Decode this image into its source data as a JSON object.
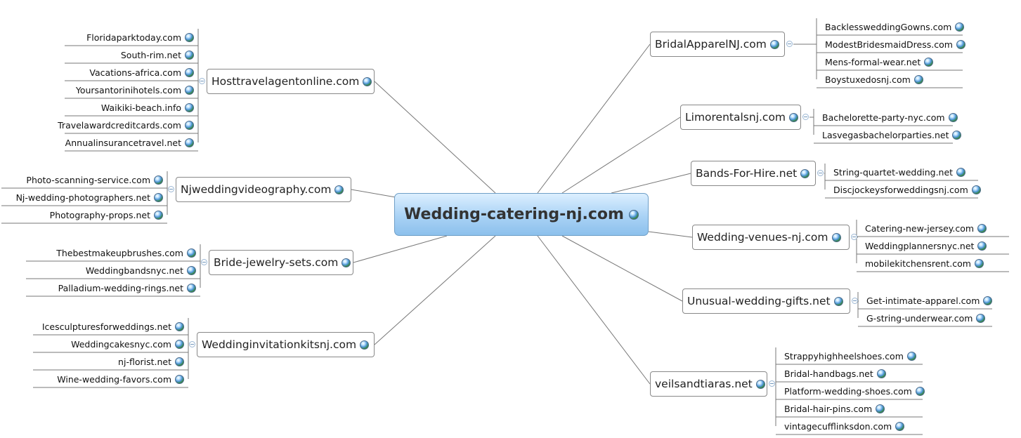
{
  "center": {
    "label": "Wedding-catering-nj.com"
  },
  "branches": [
    {
      "label": "Hosttravelagentonline.com",
      "children": [
        "Floridaparktoday.com",
        "South-rim.net",
        "Vacations-africa.com",
        "Yoursantorinihotels.com",
        "Waikiki-beach.info",
        "Travelawardcreditcards.com",
        "Annualinsurancetravel.net"
      ]
    },
    {
      "label": "Njweddingvideography.com",
      "children": [
        "Photo-scanning-service.com",
        "Nj-wedding-photographers.net",
        "Photography-props.net"
      ]
    },
    {
      "label": "Bride-jewelry-sets.com",
      "children": [
        "Thebestmakeupbrushes.com",
        "Weddingbandsnyc.net",
        "Palladium-wedding-rings.net"
      ]
    },
    {
      "label": "Weddinginvitationkitsnj.com",
      "children": [
        "Icesculpturesforweddings.net",
        "Weddingcakesnyc.com",
        "nj-florist.net",
        "Wine-wedding-favors.com"
      ]
    },
    {
      "label": "BridalApparelNJ.com",
      "children": [
        "BacklessweddingGowns.com",
        "ModestBridesmaidDress.com",
        "Mens-formal-wear.net",
        "Boystuxedosnj.com"
      ]
    },
    {
      "label": "Limorentalsnj.com",
      "children": [
        "Bachelorette-party-nyc.com",
        "Lasvegasbachelorparties.net"
      ]
    },
    {
      "label": "Bands-For-Hire.net",
      "children": [
        "String-quartet-wedding.net",
        "Discjockeysforweddingsnj.com"
      ]
    },
    {
      "label": "Wedding-venues-nj.com",
      "children": [
        "Catering-new-jersey.com",
        "Weddingplannersnyc.net",
        "mobilekitchensrent.com"
      ]
    },
    {
      "label": "Unusual-wedding-gifts.net",
      "children": [
        "Get-intimate-apparel.com",
        "G-string-underwear.com"
      ]
    },
    {
      "label": "veilsandtiaras.net",
      "children": [
        "Strappyhighheelshoes.com",
        "Bridal-handbags.net",
        "Platform-wedding-shoes.com",
        "Bridal-hair-pins.com",
        "vintagecufflinksdon.com"
      ]
    }
  ]
}
